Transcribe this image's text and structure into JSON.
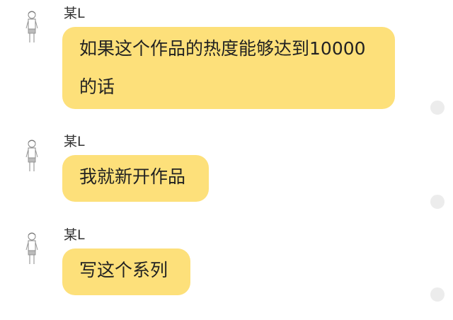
{
  "messages": [
    {
      "sender": "某L",
      "text": "如果这个作品的热度能够达到10000的话",
      "avatar_icon": "sketch-figure-avatar"
    },
    {
      "sender": "某L",
      "text": "我就新开作品",
      "avatar_icon": "sketch-figure-avatar"
    },
    {
      "sender": "某L",
      "text": "写这个系列",
      "avatar_icon": "sketch-figure-avatar"
    }
  ],
  "colors": {
    "bubble": "#fde07a",
    "read_dot": "#ececec",
    "background": "#ffffff"
  }
}
